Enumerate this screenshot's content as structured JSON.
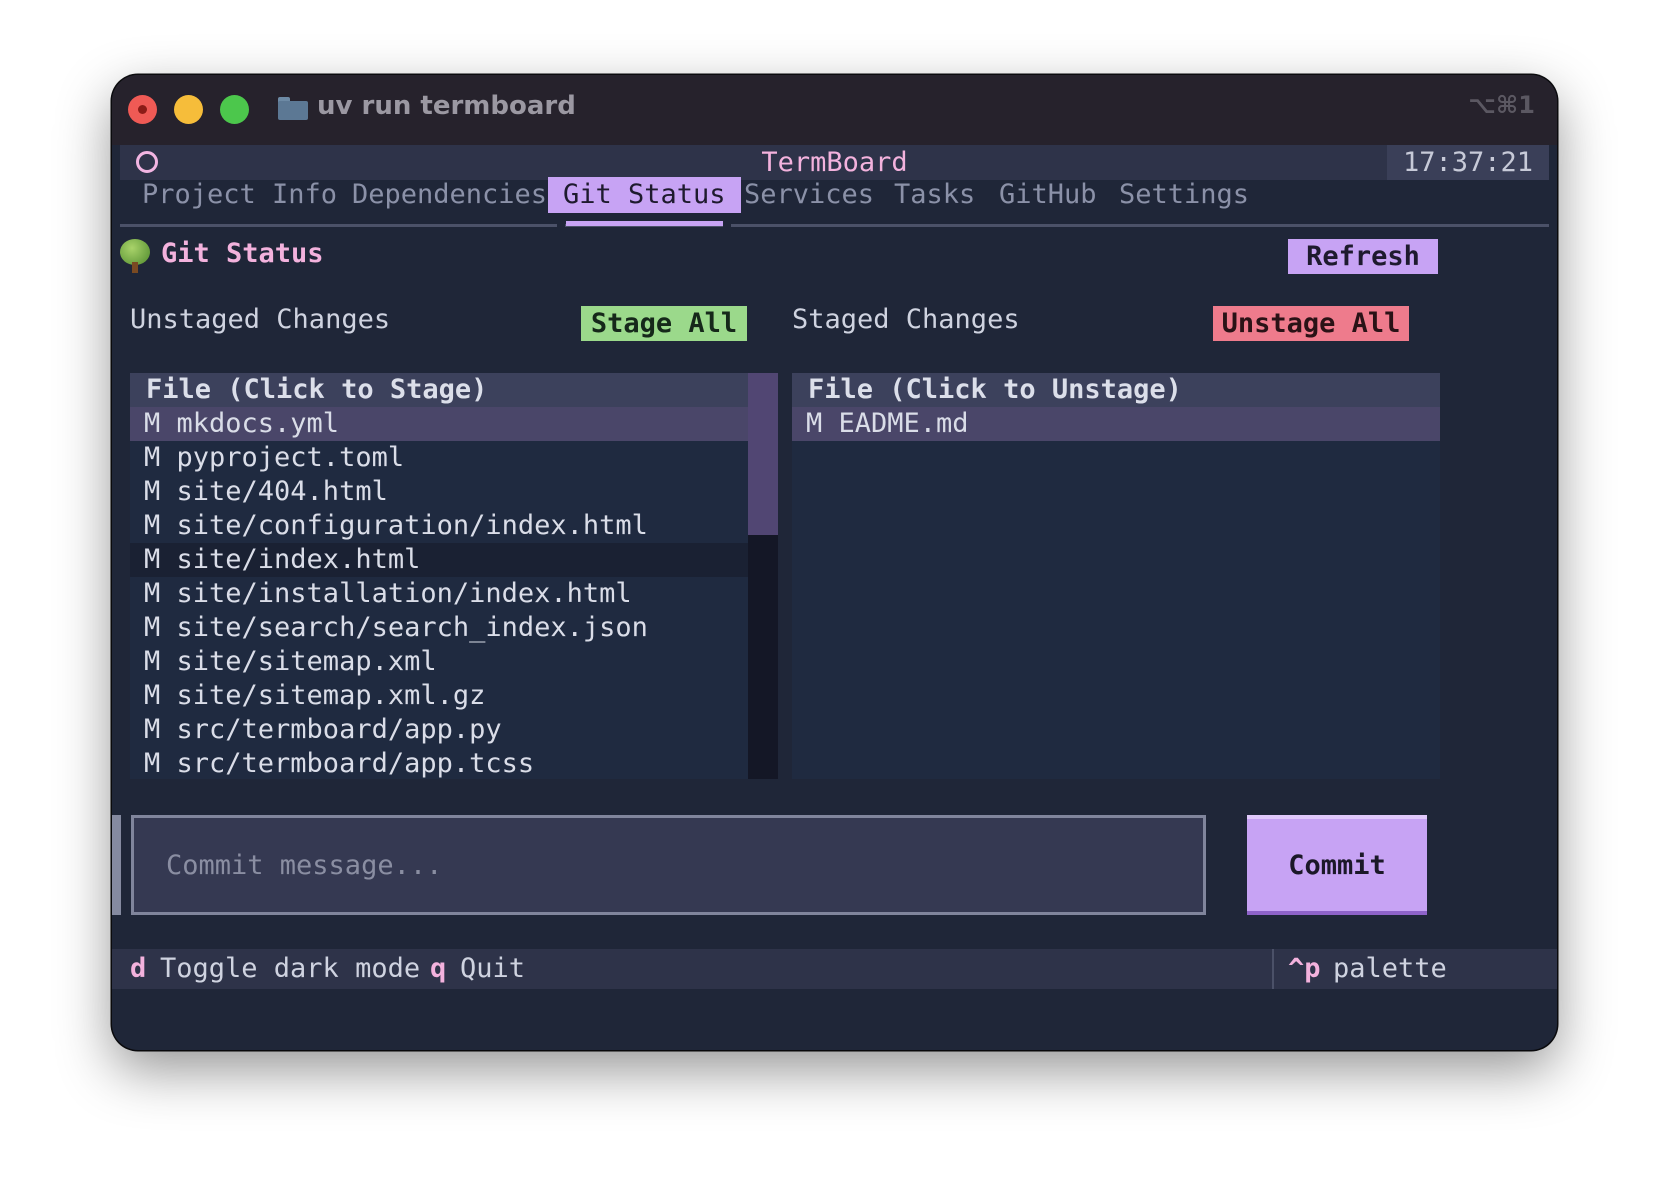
{
  "window": {
    "title": "uv run termboard",
    "shortcut": "⌥⌘1"
  },
  "header": {
    "app_title": "TermBoard",
    "clock": "17:37:21"
  },
  "tabs": [
    {
      "label": "Project Info",
      "active": false
    },
    {
      "label": "Dependencies",
      "active": false
    },
    {
      "label": "Git Status",
      "active": true
    },
    {
      "label": "Services",
      "active": false
    },
    {
      "label": "Tasks",
      "active": false
    },
    {
      "label": "GitHub",
      "active": false
    },
    {
      "label": "Settings",
      "active": false
    }
  ],
  "git": {
    "title": "Git Status",
    "refresh_label": "Refresh",
    "unstaged": {
      "label": "Unstaged Changes",
      "button": "Stage All",
      "column": "File (Click to Stage)",
      "files": [
        "M mkdocs.yml",
        "M pyproject.toml",
        "M site/404.html",
        "M site/configuration/index.html",
        "M site/index.html",
        "M site/installation/index.html",
        "M site/search/search_index.json",
        "M site/sitemap.xml",
        "M site/sitemap.xml.gz",
        "M src/termboard/app.py",
        "M src/termboard/app.tcss"
      ],
      "selected_index": 0,
      "hover_index": 4,
      "scroll_fraction": 0.4
    },
    "staged": {
      "label": "Staged Changes",
      "button": "Unstage All",
      "column": "File (Click to Unstage)",
      "files": [
        "M EADME.md"
      ],
      "selected_index": 0
    },
    "commit": {
      "placeholder": "Commit message...",
      "value": "",
      "button": "Commit"
    }
  },
  "footer": {
    "bindings": [
      {
        "key": "d",
        "label": "Toggle dark mode"
      },
      {
        "key": "q",
        "label": "Quit"
      }
    ],
    "palette": {
      "key": "^p",
      "label": "palette"
    }
  },
  "colors": {
    "accent": "#c7a3f4",
    "pink": "#f3b2dd",
    "stage_green": "#9bd98b",
    "unstage_red": "#ee7b8c",
    "background": "#1f2638"
  }
}
